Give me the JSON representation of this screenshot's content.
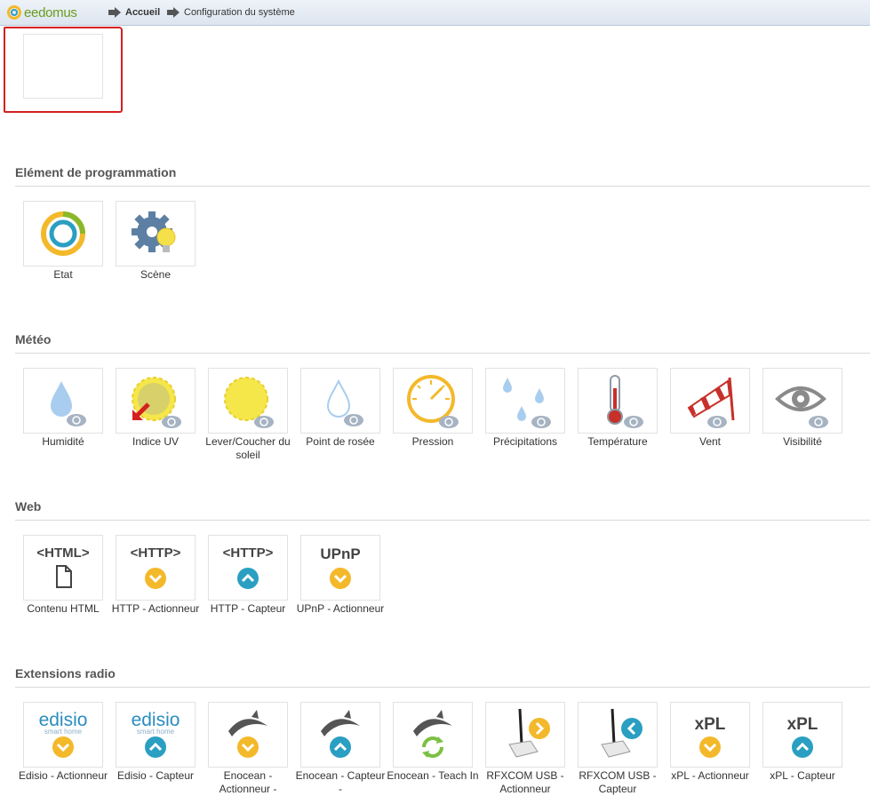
{
  "header": {
    "logo_text": "eedomus",
    "breadcrumb": [
      {
        "label": "Accueil"
      },
      {
        "label": "Configuration du système"
      }
    ]
  },
  "sections": [
    {
      "title": "Elément de programmation",
      "tiles": [
        {
          "label": "Etat",
          "icon": "etat-icon"
        },
        {
          "label": "Scène",
          "icon": "scene-icon"
        }
      ]
    },
    {
      "title": "Météo",
      "tiles": [
        {
          "label": "Humidité",
          "icon": "humidity-icon"
        },
        {
          "label": "Indice UV",
          "icon": "uv-index-icon"
        },
        {
          "label": "Lever/Coucher du soleil",
          "icon": "sunrise-sunset-icon"
        },
        {
          "label": "Point de rosée",
          "icon": "dew-point-icon"
        },
        {
          "label": "Pression",
          "icon": "pressure-icon"
        },
        {
          "label": "Précipitations",
          "icon": "precipitation-icon"
        },
        {
          "label": "Température",
          "icon": "temperature-icon"
        },
        {
          "label": "Vent",
          "icon": "wind-icon"
        },
        {
          "label": "Visibilité",
          "icon": "visibility-icon"
        }
      ]
    },
    {
      "title": "Web",
      "tiles": [
        {
          "label": "Contenu HTML",
          "icon": "html-content-icon",
          "badge_text": "<HTML>"
        },
        {
          "label": "HTTP - Actionneur",
          "icon": "http-actuator-icon",
          "badge_text": "<HTTP>"
        },
        {
          "label": "HTTP - Capteur",
          "icon": "http-sensor-icon",
          "badge_text": "<HTTP>"
        },
        {
          "label": "UPnP - Actionneur",
          "icon": "upnp-actuator-icon",
          "badge_text": "UPnP"
        }
      ]
    },
    {
      "title": "Extensions radio",
      "tiles": [
        {
          "label": "Edisio - Actionneur",
          "icon": "edisio-actuator-icon",
          "badge_text": "edisio",
          "badge_sub": "smart home"
        },
        {
          "label": "Edisio - Capteur",
          "icon": "edisio-sensor-icon",
          "badge_text": "edisio",
          "badge_sub": "smart home"
        },
        {
          "label": "Enocean - Actionneur -",
          "icon": "enocean-actuator-icon"
        },
        {
          "label": "Enocean - Capteur -",
          "icon": "enocean-sensor-icon"
        },
        {
          "label": "Enocean - Teach In",
          "icon": "enocean-teach-in-icon"
        },
        {
          "label": "RFXCOM USB - Actionneur",
          "icon": "rfxcom-actuator-icon"
        },
        {
          "label": "RFXCOM USB - Capteur",
          "icon": "rfxcom-sensor-icon"
        },
        {
          "label": "xPL - Actionneur",
          "icon": "xpl-actuator-icon",
          "badge_text": "xPL"
        },
        {
          "label": "xPL - Capteur",
          "icon": "xpl-sensor-icon",
          "badge_text": "xPL"
        }
      ]
    }
  ],
  "colors": {
    "accent_yellow": "#f3b92b",
    "accent_teal": "#2a9fc2",
    "annotation_red": "#d42020",
    "brand_green": "#6a9c1c"
  }
}
